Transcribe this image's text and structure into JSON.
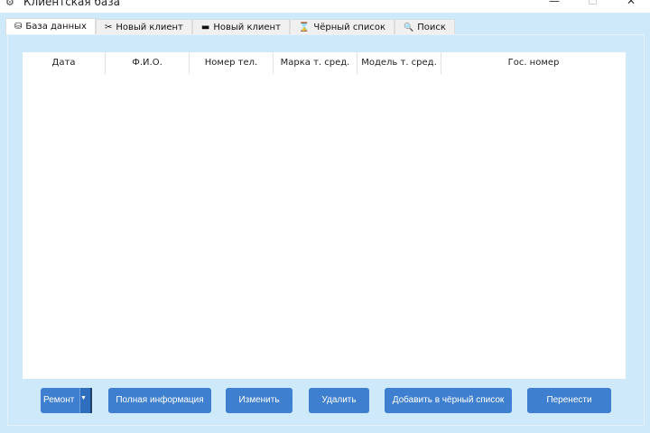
{
  "window": {
    "title": "Клиентская база",
    "minimize": "—",
    "maximize": "☐",
    "close": "✕"
  },
  "tabs": [
    {
      "label": "База данных",
      "icon": "database-icon",
      "glyph": "⛁"
    },
    {
      "label": "Новый клиент",
      "icon": "wrench-icon",
      "glyph": "✂"
    },
    {
      "label": "Новый клиент",
      "icon": "car-icon",
      "glyph": "▬"
    },
    {
      "label": "Чёрный список",
      "icon": "blacklist-icon",
      "glyph": "⌛"
    },
    {
      "label": "Поиск",
      "icon": "search-icon",
      "glyph": "🔍"
    }
  ],
  "table": {
    "columns": [
      "Дата",
      "Ф.И.О.",
      "Номер тел.",
      "Марка т. сред.",
      "Модель т. сред.",
      "Гос. номер"
    ],
    "rows": []
  },
  "buttons": {
    "repair": "Ремонт",
    "repair_arrow": "▼",
    "full_info": "Полная информация",
    "edit": "Изменить",
    "delete": "Удалить",
    "blacklist": "Добавить в чёрный список",
    "move": "Перенести"
  }
}
